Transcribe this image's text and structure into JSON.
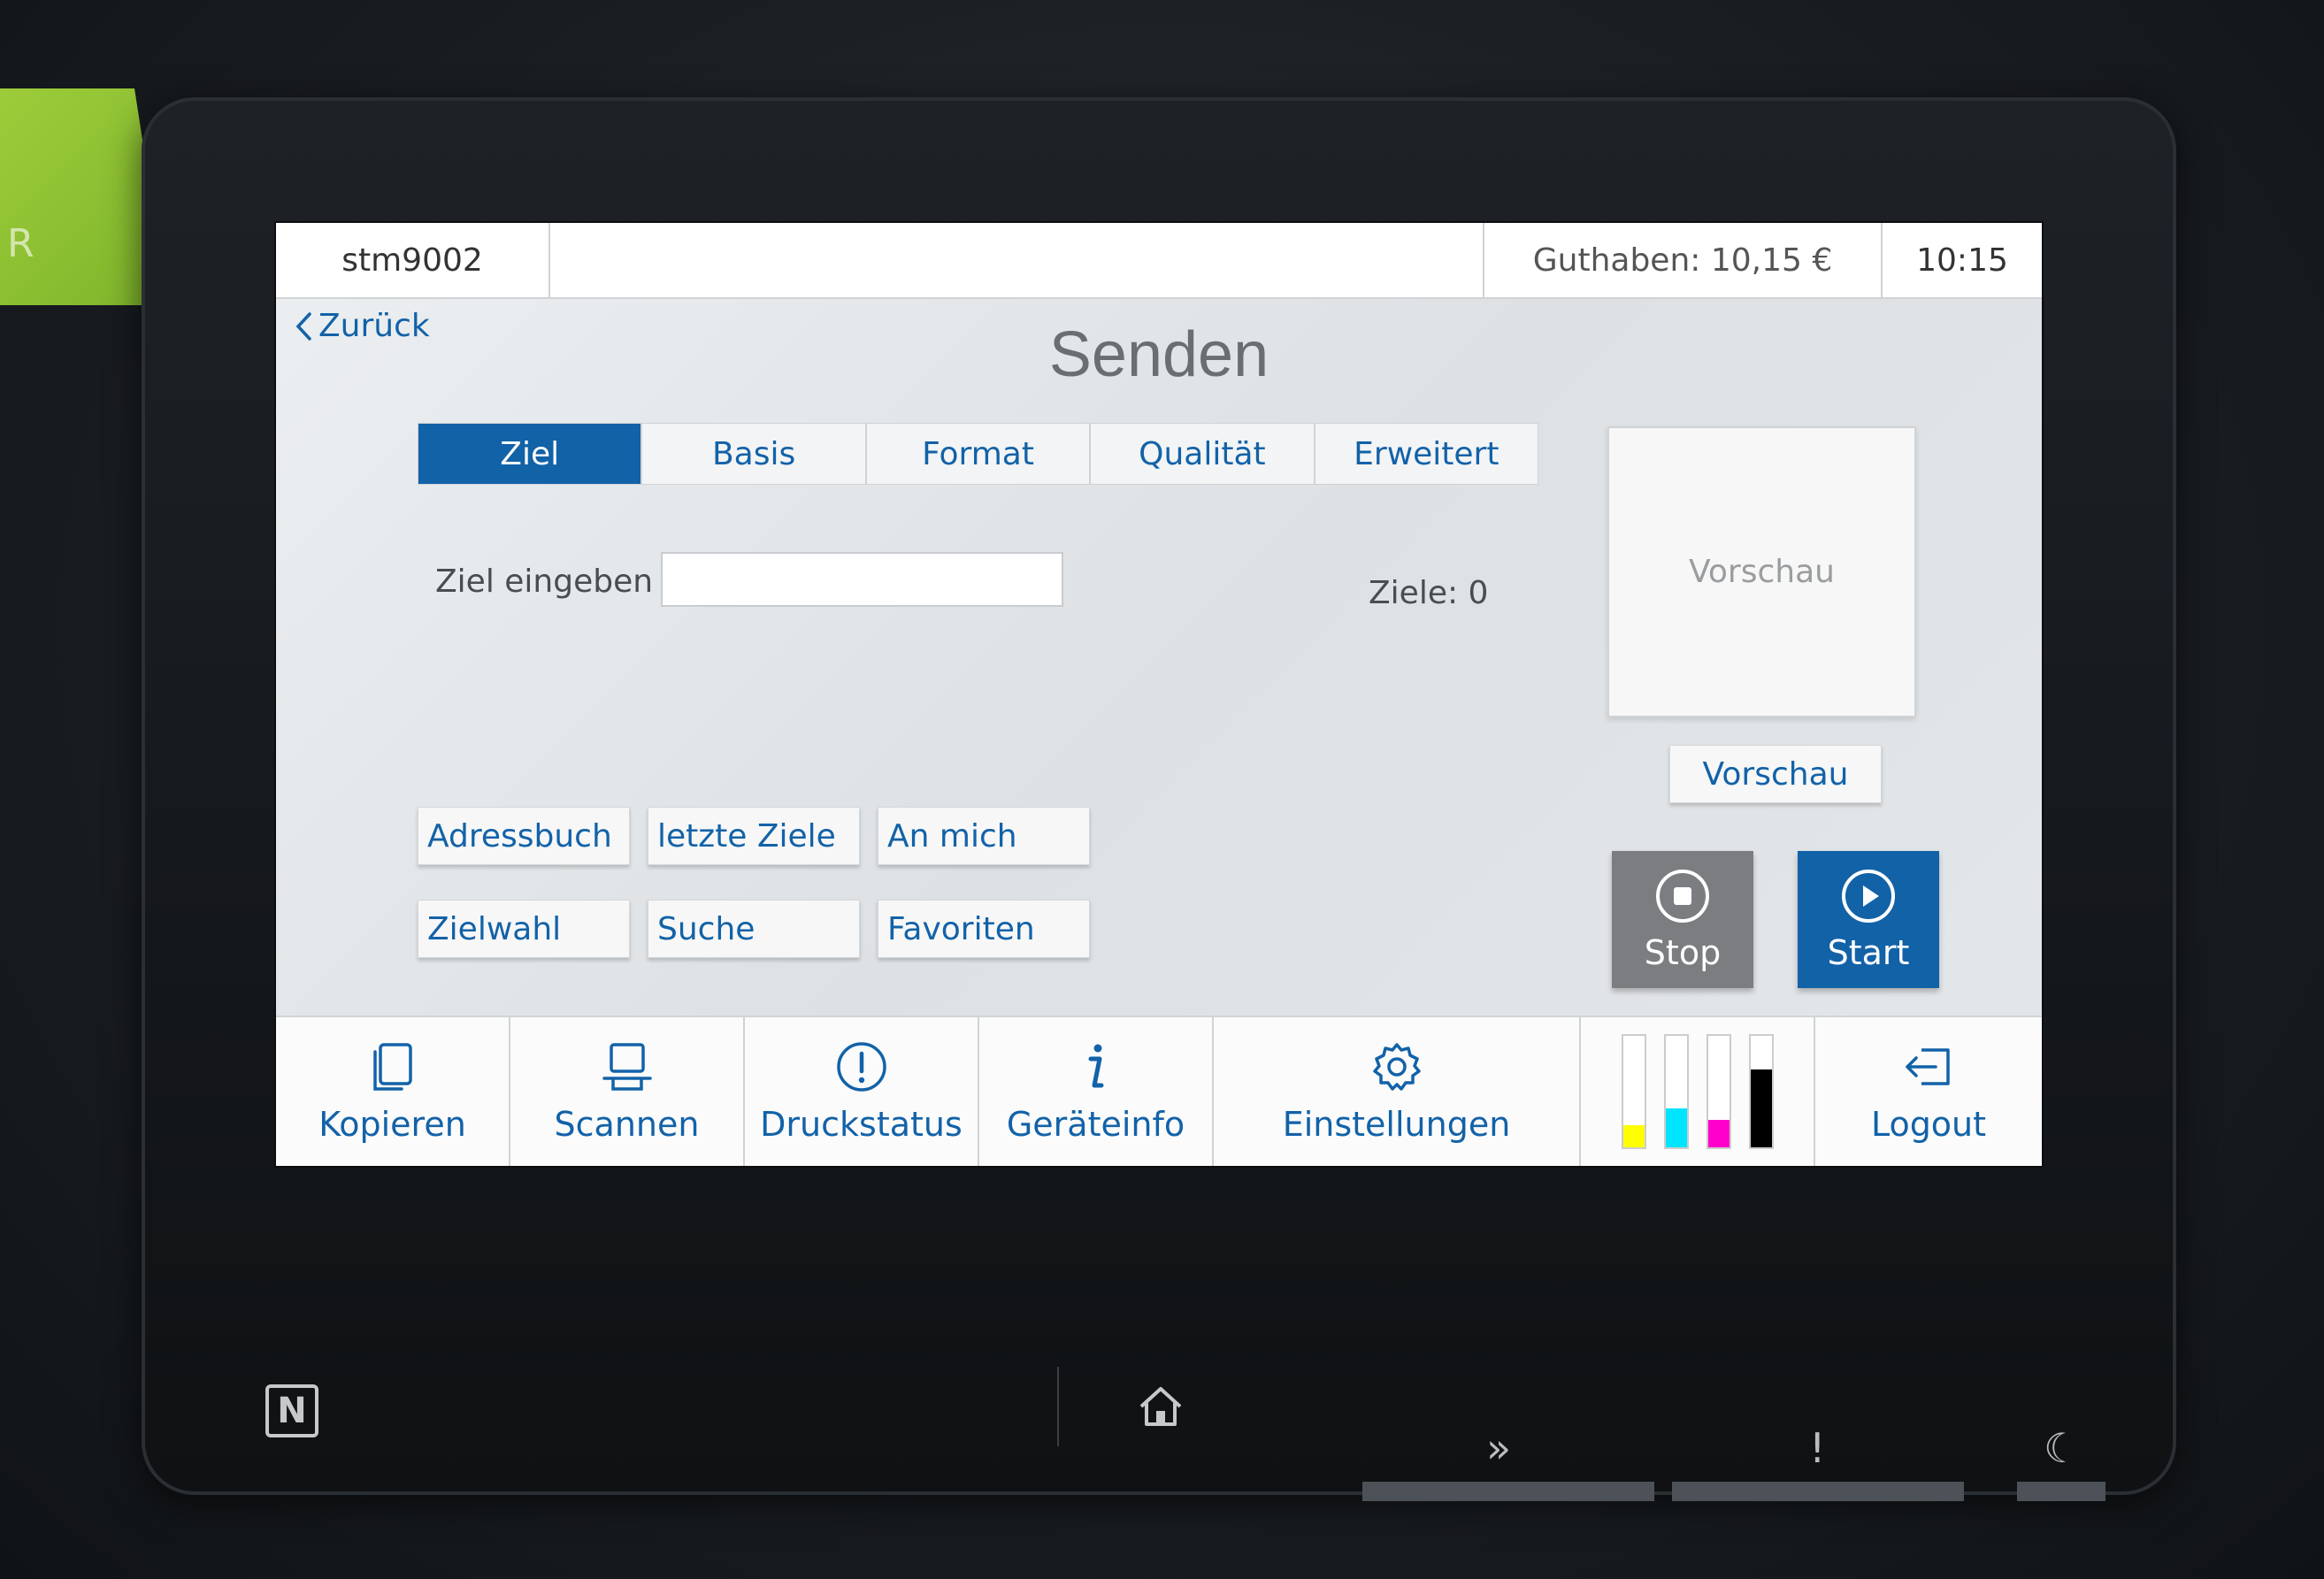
{
  "device": {
    "nfc_icon": "nfc-icon",
    "home_icon": "home-icon",
    "indicators": [
      "data-indicator-icon",
      "error-indicator-icon",
      "sleep-indicator-icon"
    ]
  },
  "statusbar": {
    "user": "stm9002",
    "credit": "Guthaben: 10,15 €",
    "time": "10:15"
  },
  "header": {
    "back_label": "Zurück",
    "title": "Senden"
  },
  "tabs": [
    {
      "label": "Ziel",
      "active": true
    },
    {
      "label": "Basis",
      "active": false
    },
    {
      "label": "Format",
      "active": false
    },
    {
      "label": "Qualität",
      "active": false
    },
    {
      "label": "Erweitert",
      "active": false
    }
  ],
  "destination": {
    "label": "Ziel eingeben",
    "value": "",
    "count_text": "Ziele: 0"
  },
  "preview": {
    "placeholder": "Vorschau",
    "button_label": "Vorschau"
  },
  "quick_buttons": {
    "adressbuch": "Adressbuch",
    "letzte_ziele": "letzte Ziele",
    "an_mich": "An mich",
    "zielwahl": "Zielwahl",
    "suche": "Suche",
    "favoriten": "Favoriten"
  },
  "actions": {
    "stop_label": "Stop",
    "start_label": "Start"
  },
  "navbar": {
    "kopieren": "Kopieren",
    "scannen": "Scannen",
    "druckstatus": "Druckstatus",
    "geraeteinfo": "Geräteinfo",
    "einstellungen": "Einstellungen",
    "logout": "Logout"
  },
  "toner": [
    {
      "color": "#ffff00",
      "level": 0.2
    },
    {
      "color": "#00e5ff",
      "level": 0.35
    },
    {
      "color": "#ff00cc",
      "level": 0.25
    },
    {
      "color": "#000000",
      "level": 0.7
    }
  ],
  "colors": {
    "accent": "#1262a8",
    "stop_gray": "#7b7d80"
  }
}
